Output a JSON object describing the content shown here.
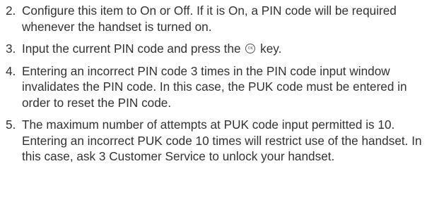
{
  "steps": [
    {
      "number": "2.",
      "text": "Configure this item to On or Off. If it is On, a PIN code will be required whenever the handset is turned on."
    },
    {
      "number": "3.",
      "text_before": "Input the current PIN code and press the",
      "icon": "ok-key-icon",
      "text_after": "key."
    },
    {
      "number": "4.",
      "text": "Entering an incorrect PIN code 3 times in the PIN code input window invalidates the PIN code. In this case, the PUK code must be entered in order to reset the PIN code."
    },
    {
      "number": "5.",
      "text": "The maximum number of attempts at PUK code input permitted is 10. Entering an incorrect PUK code 10 times will restrict use of the handset. In this case, ask 3 Customer Service to unlock your handset."
    }
  ]
}
